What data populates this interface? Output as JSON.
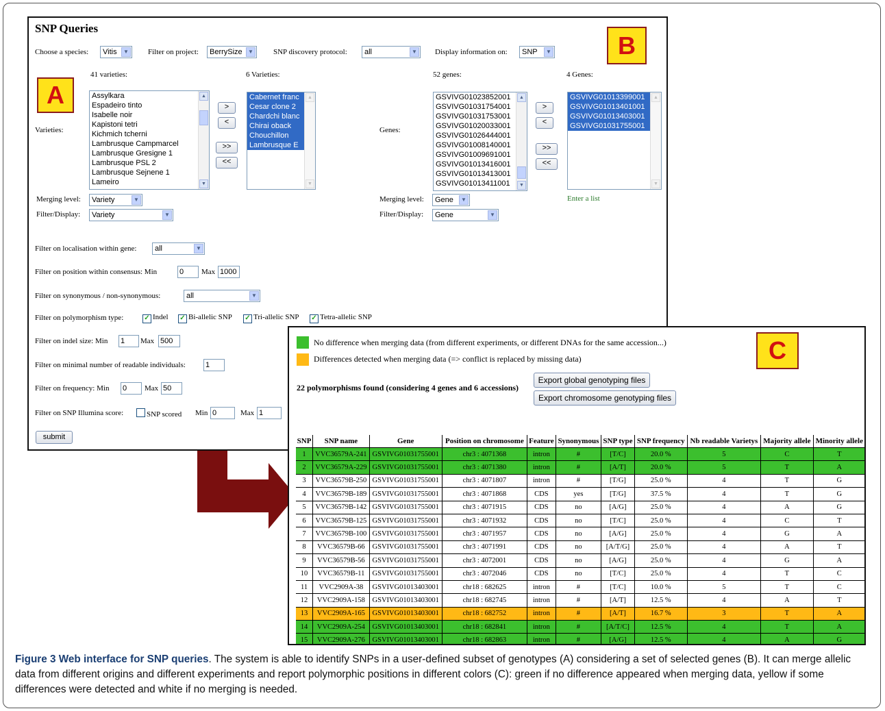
{
  "panel_a": {
    "title": "SNP Queries",
    "species_label": "Choose a species:",
    "species_value": "Vitis",
    "project_label": "Filter on project:",
    "project_value": "BerrySize",
    "protocol_label": "SNP discovery protocol:",
    "protocol_value": "all",
    "display_label": "Display information on:",
    "display_value": "SNP",
    "varieties_count": "41 varieties:",
    "varieties_selected_count": "6 Varieties:",
    "varieties_label": "Varieties:",
    "varieties_list": [
      "Assylkara",
      "Espadeiro tinto",
      "Isabelle noir",
      "Kapistoni tetri",
      "Kichmich tcherni",
      "Lambrusque Campmarcel",
      "Lambrusque Gresigne 1",
      "Lambrusque PSL 2",
      "Lambrusque Sejnene 1",
      "Lameiro"
    ],
    "varieties_selected": [
      "Cabernet franc",
      "Cesar clone 2",
      "Chardchi blanc",
      "Chirai oback",
      "Chouchillon",
      "Lambrusque E"
    ],
    "genes_count": "52 genes:",
    "genes_selected_count": "4 Genes:",
    "genes_label": "Genes:",
    "genes_list": [
      "GSVIVG01023852001",
      "GSVIVG01031754001",
      "GSVIVG01031753001",
      "GSVIVG01020033001",
      "GSVIVG01026444001",
      "GSVIVG01008140001",
      "GSVIVG01009691001",
      "GSVIVG01013416001",
      "GSVIVG01013413001",
      "GSVIVG01013411001"
    ],
    "genes_selected": [
      "GSVIVG01013399001",
      "GSVIVG01013401001",
      "GSVIVG01013403001",
      "GSVIVG01031755001"
    ],
    "move_right": ">",
    "move_left": "<",
    "move_all_right": ">>",
    "move_all_left": "<<",
    "merging_label": "Merging level:",
    "merging_variety": "Variety",
    "merging_gene": "Gene",
    "filter_display_label": "Filter/Display:",
    "filter_display_variety": "Variety",
    "filter_display_gene": "Gene",
    "enter_list": "Enter a list",
    "localisation_label": "Filter on localisation within gene:",
    "localisation_value": "all",
    "position_label": "Filter on position within consensus: Min",
    "position_min": "0",
    "max_label": "Max",
    "position_max": "1000",
    "synonymous_label": "Filter on synonymous / non-synonymous:",
    "synonymous_value": "all",
    "polymorphism_label": "Filter on polymorphism type:",
    "poly_indel": "Indel",
    "poly_bi": "Bi-allelic SNP",
    "poly_tri": "Tri-allelic SNP",
    "poly_tetra": "Tetra-allelic SNP",
    "check_mark": "✓",
    "indel_label": "Filter on indel size: Min",
    "indel_min": "1",
    "indel_max": "500",
    "readable_label": "Filter on minimal number of readable individuals:",
    "readable_value": "1",
    "frequency_label": "Filter on frequency: Min",
    "frequency_min": "0",
    "frequency_max": "50",
    "illumina_label": "Filter on SNP Illumina score:",
    "illumina_check": "SNP scored",
    "illumina_min_label": "Min",
    "illumina_min": "0",
    "illumina_max": "1",
    "submit": "submit"
  },
  "panel_c": {
    "legend_green": "No difference when merging data (from different experiments, or different DNAs for the same accession...)",
    "legend_yellow": "Differences detected when merging data (=> conflict is replaced by missing data)",
    "legend_green_color": "#3cbf2e",
    "legend_yellow_color": "#ffb915",
    "found_text": "22 polymorphisms found (considering 4 genes and 6 accessions)",
    "export_global": "Export global genotyping files",
    "export_chromosome": "Export chromosome genotyping files",
    "headers": [
      "SNP",
      "SNP name",
      "Gene",
      "Position on chromosome",
      "Feature",
      "Synonymous",
      "SNP type",
      "SNP frequency",
      "Nb readable Varietys",
      "Majority allele",
      "Minority allele"
    ],
    "rows": [
      {
        "status": "green",
        "cells": [
          "1",
          "VVC36579A-241",
          "GSVIVG01031755001",
          "chr3 : 4071368",
          "intron",
          "#",
          "[T/C]",
          "20.0 %",
          "5",
          "C",
          "T"
        ]
      },
      {
        "status": "green",
        "cells": [
          "2",
          "VVC36579A-229",
          "GSVIVG01031755001",
          "chr3 : 4071380",
          "intron",
          "#",
          "[A/T]",
          "20.0 %",
          "5",
          "T",
          "A"
        ]
      },
      {
        "status": "white",
        "cells": [
          "3",
          "VVC36579B-250",
          "GSVIVG01031755001",
          "chr3 : 4071807",
          "intron",
          "#",
          "[T/G]",
          "25.0 %",
          "4",
          "T",
          "G"
        ]
      },
      {
        "status": "white",
        "cells": [
          "4",
          "VVC36579B-189",
          "GSVIVG01031755001",
          "chr3 : 4071868",
          "CDS",
          "yes",
          "[T/G]",
          "37.5 %",
          "4",
          "T",
          "G"
        ]
      },
      {
        "status": "white",
        "cells": [
          "5",
          "VVC36579B-142",
          "GSVIVG01031755001",
          "chr3 : 4071915",
          "CDS",
          "no",
          "[A/G]",
          "25.0 %",
          "4",
          "A",
          "G"
        ]
      },
      {
        "status": "white",
        "cells": [
          "6",
          "VVC36579B-125",
          "GSVIVG01031755001",
          "chr3 : 4071932",
          "CDS",
          "no",
          "[T/C]",
          "25.0 %",
          "4",
          "C",
          "T"
        ]
      },
      {
        "status": "white",
        "cells": [
          "7",
          "VVC36579B-100",
          "GSVIVG01031755001",
          "chr3 : 4071957",
          "CDS",
          "no",
          "[A/G]",
          "25.0 %",
          "4",
          "G",
          "A"
        ]
      },
      {
        "status": "white",
        "cells": [
          "8",
          "VVC36579B-66",
          "GSVIVG01031755001",
          "chr3 : 4071991",
          "CDS",
          "no",
          "[A/T/G]",
          "25.0 %",
          "4",
          "A",
          "T"
        ]
      },
      {
        "status": "white",
        "cells": [
          "9",
          "VVC36579B-56",
          "GSVIVG01031755001",
          "chr3 : 4072001",
          "CDS",
          "no",
          "[A/G]",
          "25.0 %",
          "4",
          "G",
          "A"
        ]
      },
      {
        "status": "white",
        "cells": [
          "10",
          "VVC36579B-11",
          "GSVIVG01031755001",
          "chr3 : 4072046",
          "CDS",
          "no",
          "[T/C]",
          "25.0 %",
          "4",
          "T",
          "C"
        ]
      },
      {
        "status": "white",
        "cells": [
          "11",
          "VVC2909A-38",
          "GSVIVG01013403001",
          "chr18 : 682625",
          "intron",
          "#",
          "[T/C]",
          "10.0 %",
          "5",
          "T",
          "C"
        ]
      },
      {
        "status": "white",
        "cells": [
          "12",
          "VVC2909A-158",
          "GSVIVG01013403001",
          "chr18 : 682745",
          "intron",
          "#",
          "[A/T]",
          "12.5 %",
          "4",
          "A",
          "T"
        ]
      },
      {
        "status": "yellow",
        "cells": [
          "13",
          "VVC2909A-165",
          "GSVIVG01013403001",
          "chr18 : 682752",
          "intron",
          "#",
          "[A/T]",
          "16.7 %",
          "3",
          "T",
          "A"
        ]
      },
      {
        "status": "green",
        "cells": [
          "14",
          "VVC2909A-254",
          "GSVIVG01013403001",
          "chr18 : 682841",
          "intron",
          "#",
          "[A/T/C]",
          "12.5 %",
          "4",
          "T",
          "A"
        ]
      },
      {
        "status": "green",
        "cells": [
          "15",
          "VVC2909A-276",
          "GSVIVG01013403001",
          "chr18 : 682863",
          "intron",
          "#",
          "[A/G]",
          "12.5 %",
          "4",
          "A",
          "G"
        ]
      }
    ]
  },
  "labels": {
    "a": "A",
    "b": "B",
    "c": "C"
  },
  "arrow_color": "#7a0f0f",
  "caption": {
    "bold": "Figure 3 Web interface for SNP queries",
    "text": ". The system is able to identify SNPs in a user-defined subset of genotypes (A) considering a set of selected genes (B). It can merge allelic data from different origins and different experiments and report polymorphic positions in different colors (C): green if no difference appeared when merging data, yellow if some differences were detected and white if no merging is needed."
  }
}
